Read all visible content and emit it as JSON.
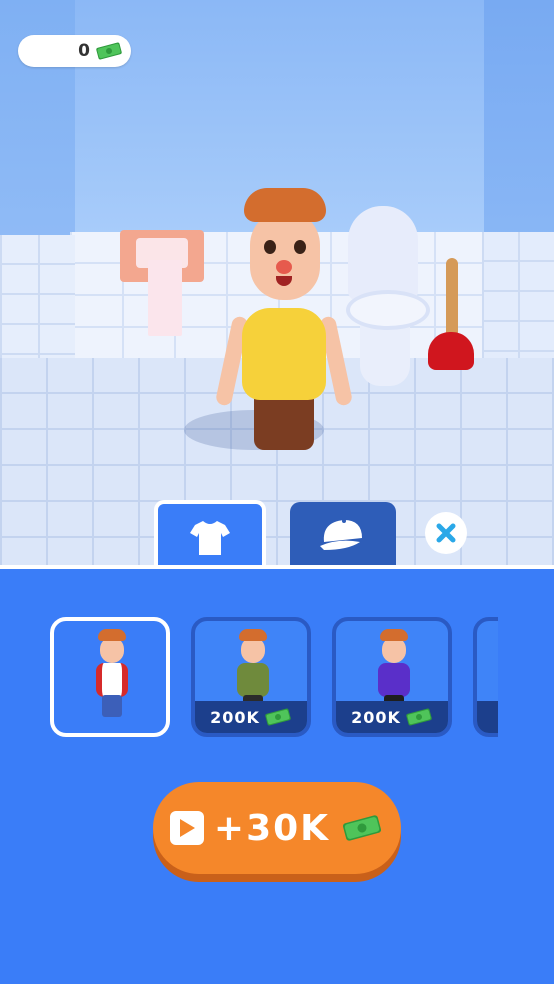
{
  "hud": {
    "coins": "0",
    "coin_icon": "cash-icon"
  },
  "tabs": [
    {
      "name": "shirt",
      "icon": "tshirt-icon",
      "active": true
    },
    {
      "name": "cap",
      "icon": "cap-icon",
      "active": false
    }
  ],
  "close_icon": "close-icon",
  "skins": [
    {
      "shirt_color": "#d62a2a",
      "selected": true,
      "price": null
    },
    {
      "shirt_color": "#6f8a3c",
      "selected": false,
      "price": "200K"
    },
    {
      "shirt_color": "#5a2fc9",
      "selected": false,
      "price": "200K"
    }
  ],
  "ad_button": {
    "label": "+30K",
    "icon": "video-play-icon"
  },
  "colors": {
    "panel": "#3a7df8",
    "ad_button": "#f5872a",
    "price_bar": "#1c3f8c"
  }
}
